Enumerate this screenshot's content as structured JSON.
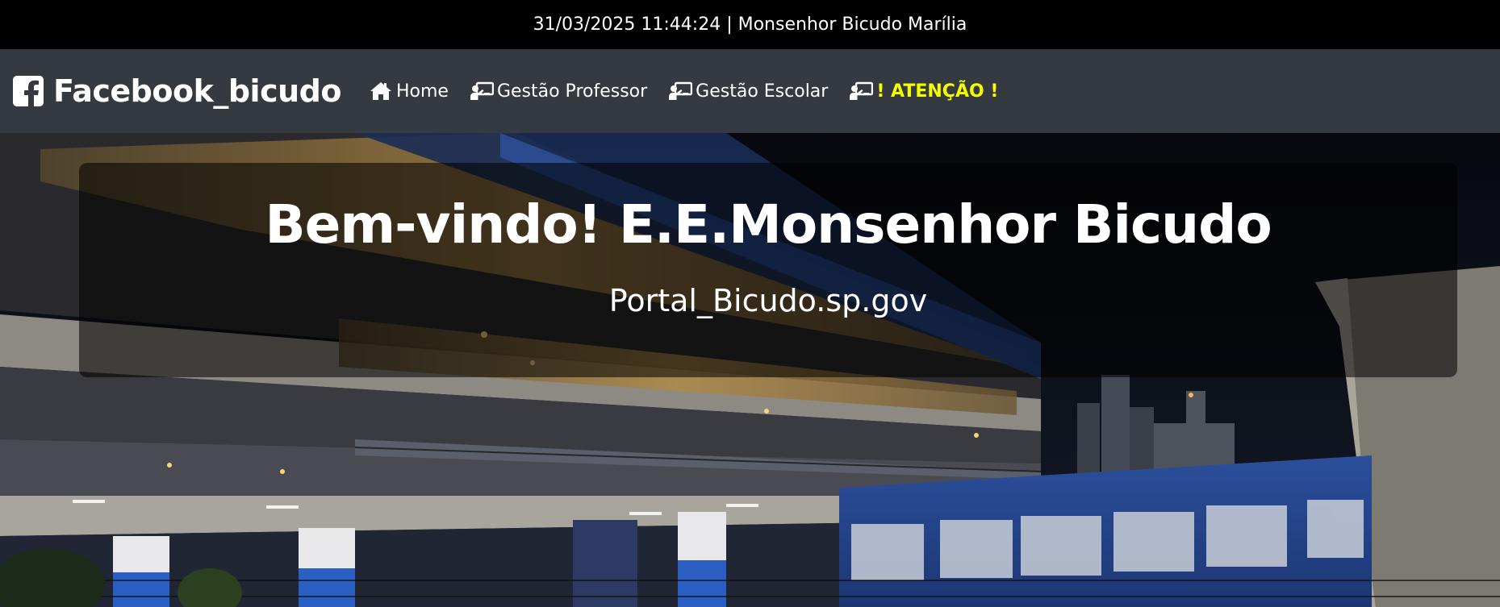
{
  "topbar": {
    "text": "31/03/2025 11:44:24 | Monsenhor Bicudo Marília"
  },
  "navbar": {
    "brand": {
      "icon": "facebook-square-icon",
      "label": "Facebook_bicudo"
    },
    "links": [
      {
        "icon": "home-icon",
        "label": "Home"
      },
      {
        "icon": "chalkboard-teacher-icon",
        "label": "Gestão Professor"
      },
      {
        "icon": "chalkboard-teacher-icon",
        "label": "Gestão Escolar"
      },
      {
        "icon": "chalkboard-teacher-icon",
        "label": "! ATENÇÃO !"
      }
    ]
  },
  "hero": {
    "title": "Bem-vindo! E.E.Monsenhor Bicudo",
    "subtitle": "Portal_Bicudo.sp.gov"
  },
  "colors": {
    "topbar_bg": "#000000",
    "navbar_bg": "#343a40",
    "alert_text": "#f5ff00",
    "text": "#ffffff"
  }
}
